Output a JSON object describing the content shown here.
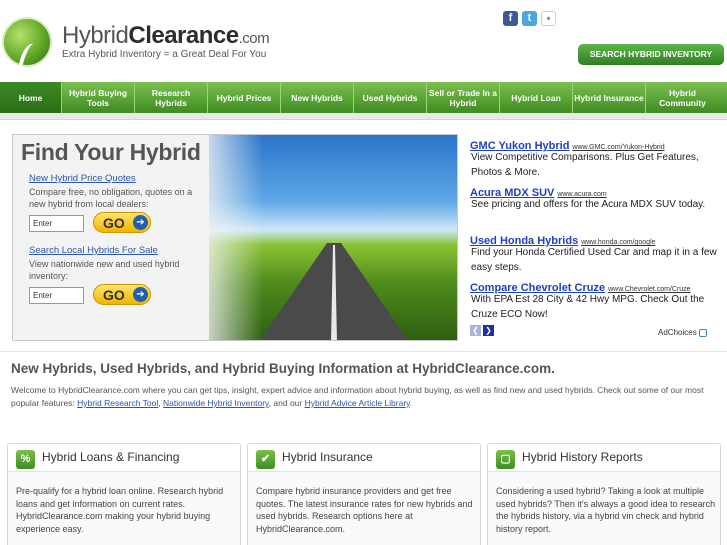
{
  "header": {
    "logo_prefix": "Hybrid",
    "logo_strong": "Clearance",
    "logo_suffix": ".com",
    "tagline": "Extra Hybrid Inventory = a Great Deal For You",
    "social": {
      "facebook": "f",
      "twitter": "t",
      "other": "•"
    },
    "search_inventory_button": "SEARCH HYBRID INVENTORY"
  },
  "nav": {
    "items": [
      {
        "label": "Home"
      },
      {
        "label": "Hybrid Buying Tools"
      },
      {
        "label": "Research Hybrids"
      },
      {
        "label": "Hybrid Prices"
      },
      {
        "label": "New Hybrids"
      },
      {
        "label": "Used Hybrids"
      },
      {
        "label": "Sell or Trade In a Hybrid"
      },
      {
        "label": "Hybrid Loan"
      },
      {
        "label": "Hybrid Insurance"
      },
      {
        "label": "Hybrid Community"
      }
    ]
  },
  "hero": {
    "title": "Find Your Hybrid",
    "quote_link": "New Hybrid Price Quotes",
    "quote_text": "Compare free, no obligation, quotes on a new hybrid from local dealers:",
    "quote_input_value": "Enter",
    "search_link": "Search Local Hybrids For Sale",
    "search_text": "View nationwide new and used hybrid inventory:",
    "search_input_value": "Enter",
    "go_label": "GO",
    "go_arrow": "➔"
  },
  "ads": {
    "items": [
      {
        "title": "GMC Yukon Hybrid",
        "url": "www.GMC.com/Yukon-Hybrid",
        "desc": "View Competitive Comparisons. Plus Get Features, Photos & More."
      },
      {
        "title": "Acura MDX SUV",
        "url": "www.acura.com",
        "desc": "See pricing and offers for the Acura MDX SUV today."
      },
      {
        "title": "Used Honda Hybrids",
        "url": "www.honda.com/google",
        "desc": "Find your Honda Certified Used Car and map it in a few easy steps."
      },
      {
        "title": "Compare Chevrolet Cruze",
        "url": "www.Chevrolet.com/Cruze",
        "desc": "With EPA Est 28 City & 42 Hwy MPG. Check Out the Cruze ECO Now!"
      }
    ],
    "prev": "❮",
    "next": "❯",
    "adchoices": "AdChoices"
  },
  "intro": {
    "title": "New Hybrids, Used Hybrids, and Hybrid Buying Information at HybridClearance.com.",
    "text_before": "Welcome to HybridClearance.com where you can get tips, insight, expert advice and information about hybrid buying, as well as find new and used hybrids.  Check out some of our most popular features: ",
    "link1": "Hybrid Research Tool",
    "sep1": ", ",
    "link2": "Nationwide Hybrid Inventory",
    "sep2": ", and our ",
    "link3": "Hybrid Advice Article Library",
    "text_after": "."
  },
  "boxes": [
    {
      "icon": "%",
      "title": "Hybrid Loans & Financing",
      "text": "Pre-qualify for a hybrid loan online. Research hybrid loans and get information on current rates. HybridClearance.com making your hybrid buying experience easy."
    },
    {
      "icon": "✔",
      "title": "Hybrid Insurance",
      "text": "Compare hybrid insurance providers and get free quotes. The latest insurance rates for new hybrids and used hybrids. Research options here at HybridClearance.com."
    },
    {
      "icon": "▢",
      "title": "Hybrid History Reports",
      "text": "Considering a used hybrid? Taking a look at multiple used hybrids? Then it's always a good idea to research the hybrids history, via a hybrid vin check and hybrid history report."
    }
  ]
}
